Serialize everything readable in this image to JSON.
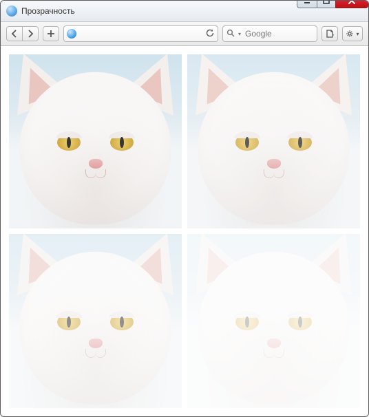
{
  "window": {
    "title": "Прозрачность"
  },
  "toolbar": {
    "address_value": "",
    "search_placeholder": "Google"
  },
  "content": {
    "images": [
      {
        "label": "cat-opacity-100",
        "opacity": 1.0
      },
      {
        "label": "cat-opacity-80",
        "opacity": 0.8
      },
      {
        "label": "cat-opacity-55",
        "opacity": 0.55
      },
      {
        "label": "cat-opacity-25",
        "opacity": 0.25
      }
    ]
  }
}
